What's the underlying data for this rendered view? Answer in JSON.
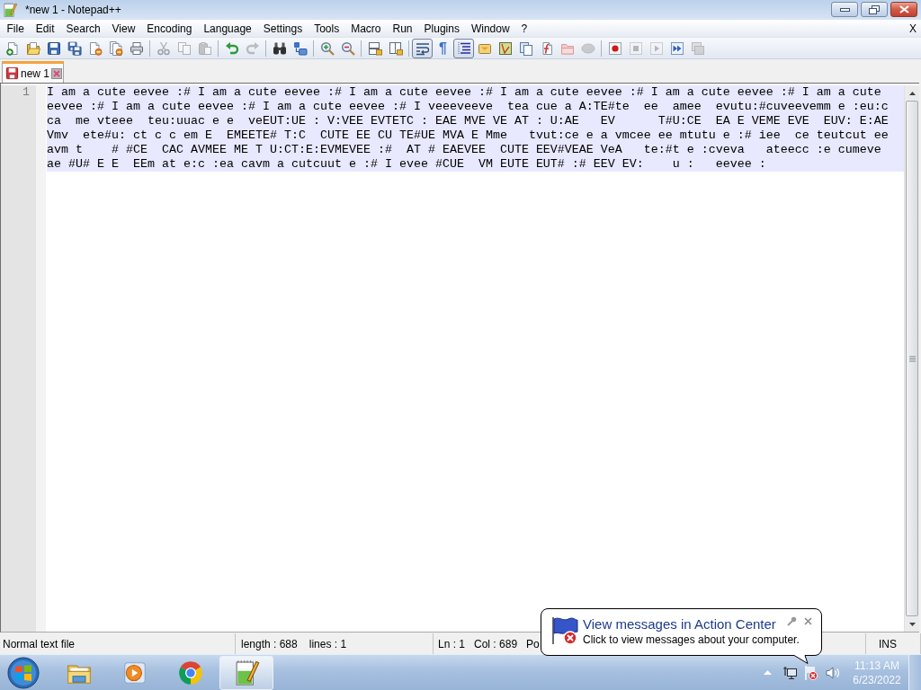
{
  "window": {
    "title": "*new 1 - Notepad++"
  },
  "menu_bar": {
    "items": [
      "File",
      "Edit",
      "Search",
      "View",
      "Encoding",
      "Language",
      "Settings",
      "Tools",
      "Macro",
      "Run",
      "Plugins",
      "Window",
      "?"
    ],
    "close_label": "X"
  },
  "toolbar": {
    "groups": [
      [
        {
          "kind": "new",
          "disabled": false,
          "pressed": false
        },
        {
          "kind": "open",
          "disabled": false,
          "pressed": false
        },
        {
          "kind": "save",
          "disabled": false,
          "pressed": false
        },
        {
          "kind": "saveall",
          "disabled": false,
          "pressed": false
        },
        {
          "kind": "close",
          "disabled": false,
          "pressed": false
        },
        {
          "kind": "closeall",
          "disabled": false,
          "pressed": false
        },
        {
          "kind": "print",
          "disabled": false,
          "pressed": false
        }
      ],
      [
        {
          "kind": "cut",
          "disabled": true,
          "pressed": false
        },
        {
          "kind": "copy",
          "disabled": true,
          "pressed": false
        },
        {
          "kind": "paste",
          "disabled": true,
          "pressed": false
        }
      ],
      [
        {
          "kind": "undo",
          "disabled": false,
          "pressed": false
        },
        {
          "kind": "redo",
          "disabled": true,
          "pressed": false
        }
      ],
      [
        {
          "kind": "find",
          "disabled": false,
          "pressed": false
        },
        {
          "kind": "replace",
          "disabled": false,
          "pressed": false
        }
      ],
      [
        {
          "kind": "zoomin",
          "disabled": false,
          "pressed": false
        },
        {
          "kind": "zoomout",
          "disabled": false,
          "pressed": false
        }
      ],
      [
        {
          "kind": "syncv",
          "disabled": false,
          "pressed": false
        },
        {
          "kind": "synch",
          "disabled": false,
          "pressed": false
        }
      ],
      [
        {
          "kind": "wrap",
          "disabled": false,
          "pressed": true
        },
        {
          "kind": "allchars",
          "label": "¶",
          "disabled": false,
          "pressed": false
        },
        {
          "kind": "indent",
          "disabled": false,
          "pressed": true
        },
        {
          "kind": "userlang",
          "disabled": false,
          "pressed": false
        },
        {
          "kind": "docmap",
          "disabled": false,
          "pressed": false
        },
        {
          "kind": "doclist",
          "disabled": false,
          "pressed": false
        },
        {
          "kind": "funclist",
          "disabled": false,
          "pressed": false
        },
        {
          "kind": "workspace",
          "disabled": false,
          "pressed": false
        },
        {
          "kind": "monitor",
          "disabled": true,
          "pressed": false
        }
      ],
      [
        {
          "kind": "record",
          "disabled": false,
          "pressed": false
        },
        {
          "kind": "stop",
          "disabled": true,
          "pressed": false
        },
        {
          "kind": "play",
          "disabled": true,
          "pressed": false
        },
        {
          "kind": "playmulti",
          "disabled": false,
          "pressed": false
        },
        {
          "kind": "savemacro",
          "disabled": true,
          "pressed": false
        }
      ]
    ]
  },
  "tabs": [
    {
      "label": "new 1",
      "selected": true,
      "modified": true
    }
  ],
  "editor": {
    "lines": [
      {
        "number": "1",
        "current": true,
        "wrapped": [
          "I am a cute eevee :# I am a cute eevee :# I am a cute eevee :# I am a cute eevee :# I am a cute eevee :# I am a cute",
          "eevee :# I am a cute eevee :# I am a cute eevee :# I veeeveeve  tea cue a A:TE#te  ee  amee  evutu:#cuveevemm e :eu:c",
          "ca  me vteee  teu:uuac e e  veEUT:UE : V:VEE EVTETC : EAE MVE VE AT : U:AE   EV      T#U:CE  EA E VEME EVE  EUV: E:AE",
          "Vmv  ete#u: ct c c em E  EMEETE# T:C  CUTE EE CU TE#UE MVA E Mme   tvut:ce e a vmcee ee mtutu e :# iee  ce teutcut ee",
          "avm t    # #CE  CAC AVMEE ME T U:CT:E:EVMEVEE :#  AT # EAEVEE  CUTE EEV#VEAE VeA   te:#t e :cveva   ateecc :e cumeve",
          "ae #U# E E  EEm at e:c :ea cavm a cutcuut e :# I evee #CUE  VM EUTE EUT# :# EEV EV:    u :   eevee :"
        ]
      }
    ]
  },
  "status_bar": {
    "doc_type": "Normal text file",
    "length": "length : 688",
    "lines": "lines : 1",
    "line": "Ln : 1",
    "column": "Col : 689",
    "position": "Po",
    "mode": "INS"
  },
  "taskbar": {
    "apps": [
      {
        "kind": "explorer",
        "active": false
      },
      {
        "kind": "media",
        "active": false
      },
      {
        "kind": "browser",
        "active": false
      },
      {
        "kind": "notepad",
        "active": true
      }
    ],
    "clock": {
      "time": "11:13 AM",
      "date": "6/23/2022"
    }
  },
  "notification": {
    "title": "View messages in Action Center",
    "message": "Click to view messages about your computer."
  }
}
